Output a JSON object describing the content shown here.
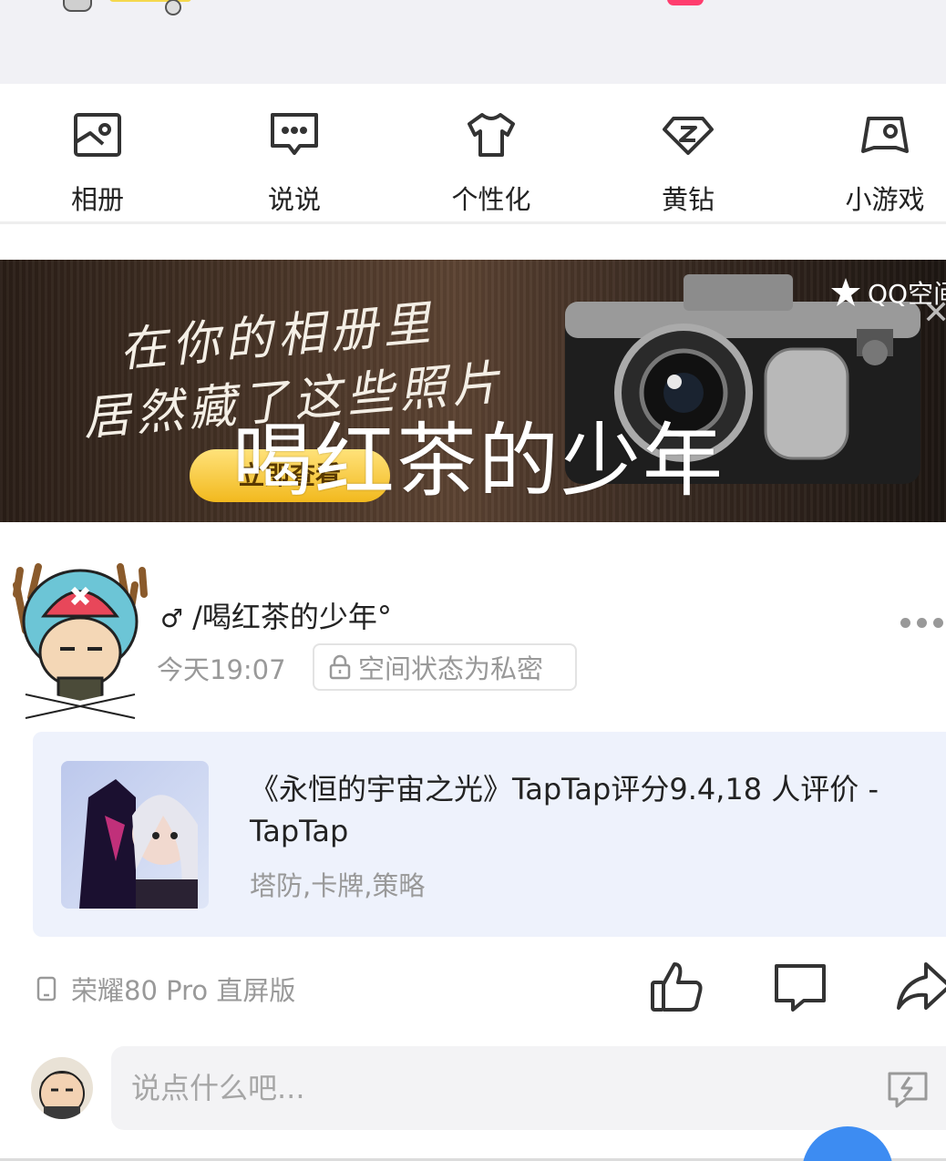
{
  "nav": {
    "items": [
      {
        "label": "相册",
        "icon": "photo-album-icon"
      },
      {
        "label": "说说",
        "icon": "chat-bubble-icon"
      },
      {
        "label": "个性化",
        "icon": "tshirt-icon"
      },
      {
        "label": "黄钻",
        "icon": "diamond-icon"
      },
      {
        "label": "小游戏",
        "icon": "gamepad-icon"
      }
    ]
  },
  "banner": {
    "line1": "在你的相册里",
    "line2": "居然藏了这些照片",
    "button_label": "立即查看",
    "overlay_text": "喝红茶的少年",
    "logo_text": "QQ空间",
    "close_symbol": "✕"
  },
  "post": {
    "gender_symbol": "♂",
    "author": "/喝红茶的少年°",
    "time": "今天19:07",
    "privacy_label": "空间状态为私密",
    "share": {
      "title": "《永恒的宇宙之光》TapTap评分9.4,18 人评价 - TapTap",
      "subtitle": "塔防,卡牌,策略"
    },
    "device": "荣耀80 Pro 直屏版"
  },
  "comment": {
    "placeholder": "说点什么吧..."
  },
  "colors": {
    "accent_blue": "#3d8cf2",
    "card_bg": "#eef2fc",
    "muted_text": "#999999"
  }
}
